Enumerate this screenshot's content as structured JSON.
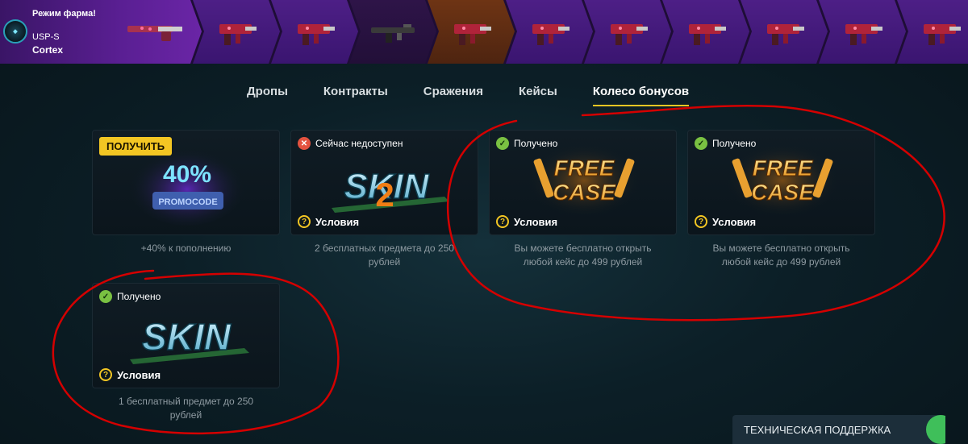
{
  "farm": {
    "mode_label": "Режим фарма!",
    "weapon": "USP-S",
    "skin": "Cortex"
  },
  "strip": {
    "items": [
      {
        "weapon": "mp9",
        "tone": "purple"
      },
      {
        "weapon": "mp9",
        "tone": "purple"
      },
      {
        "weapon": "rifle",
        "tone": "dark"
      },
      {
        "weapon": "mp9",
        "tone": "orange"
      },
      {
        "weapon": "mp9",
        "tone": "purple"
      },
      {
        "weapon": "mp9",
        "tone": "purple"
      },
      {
        "weapon": "mp9",
        "tone": "purple"
      },
      {
        "weapon": "mp9",
        "tone": "purple"
      },
      {
        "weapon": "mp9",
        "tone": "purple"
      },
      {
        "weapon": "mp9",
        "tone": "purple"
      }
    ]
  },
  "tabs": [
    {
      "label": "Дропы"
    },
    {
      "label": "Контракты"
    },
    {
      "label": "Сражения"
    },
    {
      "label": "Кейсы"
    },
    {
      "label": "Колесо бонусов",
      "active": true
    }
  ],
  "cards": [
    {
      "button": "ПОЛУЧИТЬ",
      "art_text": "40%",
      "art_sub": "PROMOCODE",
      "desc_line1": "+40% к пополнению",
      "desc_line2": ""
    },
    {
      "status": "Сейчас недоступен",
      "status_type": "unavailable",
      "art_text": "SKIN",
      "art_num": "2",
      "conditions": "Условия",
      "desc_line1": "2 бесплатных предмета до 250",
      "desc_line2": "рублей"
    },
    {
      "status": "Получено",
      "status_type": "received",
      "art_text": "FREE",
      "art_text2": "CASE",
      "conditions": "Условия",
      "desc_line1": "Вы можете бесплатно открыть",
      "desc_line2": "любой кейс до 499 рублей"
    },
    {
      "status": "Получено",
      "status_type": "received",
      "art_text": "FREE",
      "art_text2": "CASE",
      "conditions": "Условия",
      "desc_line1": "Вы можете бесплатно открыть",
      "desc_line2": "любой кейс до 499 рублей"
    },
    {
      "status": "Получено",
      "status_type": "received",
      "art_text": "SKIN",
      "conditions": "Условия",
      "desc_line1": "1 бесплатный предмет до 250",
      "desc_line2": "рублей"
    }
  ],
  "support": {
    "label": "ТЕХНИЧЕСКАЯ ПОДДЕРЖКА"
  },
  "colors": {
    "accent": "#f3c623",
    "received": "#7ac142",
    "unavailable": "#e4523f",
    "annotation": "#d40000"
  }
}
